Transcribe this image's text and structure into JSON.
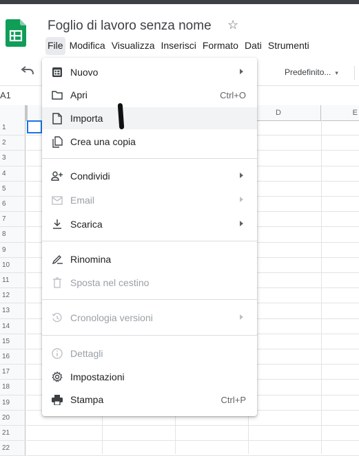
{
  "app": {
    "title": "Foglio di lavoro senza nome",
    "star_icon": "star-outline-icon",
    "logo_icon": "google-sheets-logo-icon"
  },
  "menubar": [
    "File",
    "Modifica",
    "Visualizza",
    "Inserisci",
    "Formato",
    "Dati",
    "Strumenti"
  ],
  "active_menu": "File",
  "toolbar": {
    "undo_icon": "undo-icon",
    "font": "Predefinito...",
    "font_caret": "▾"
  },
  "name_box": "A1",
  "grid": {
    "col_headers": [
      "D",
      "E"
    ],
    "row_headers": [
      "1",
      "2",
      "3",
      "4",
      "5",
      "6",
      "7",
      "8",
      "9",
      "10",
      "11",
      "12",
      "13",
      "14",
      "15",
      "16",
      "17",
      "18",
      "19",
      "20",
      "21",
      "22"
    ]
  },
  "file_menu": {
    "items": [
      {
        "label": "Nuovo",
        "icon": "new-spreadsheet-icon",
        "submenu": true,
        "disabled": false
      },
      {
        "label": "Apri",
        "icon": "folder-icon",
        "shortcut": "Ctrl+O",
        "disabled": false
      },
      {
        "label": "Importa",
        "icon": "file-icon",
        "disabled": false,
        "highlighted": true
      },
      {
        "label": "Crea una copia",
        "icon": "copy-icon",
        "disabled": false
      },
      {
        "label": "Condividi",
        "icon": "share-person-icon",
        "submenu": true,
        "disabled": false
      },
      {
        "label": "Email",
        "icon": "email-icon",
        "submenu": true,
        "disabled": true
      },
      {
        "label": "Scarica",
        "icon": "download-icon",
        "submenu": true,
        "disabled": false
      },
      {
        "label": "Rinomina",
        "icon": "rename-icon",
        "disabled": false
      },
      {
        "label": "Sposta nel cestino",
        "icon": "trash-icon",
        "disabled": true
      },
      {
        "label": "Cronologia versioni",
        "icon": "history-icon",
        "submenu": true,
        "disabled": true
      },
      {
        "label": "Dettagli",
        "icon": "info-icon",
        "disabled": true
      },
      {
        "label": "Impostazioni",
        "icon": "gear-icon",
        "disabled": false
      },
      {
        "label": "Stampa",
        "icon": "print-icon",
        "shortcut": "Ctrl+P",
        "disabled": false
      }
    ]
  },
  "colors": {
    "accent": "#1a73e8",
    "sheets_green": "#0f9d58",
    "disabled": "#9aa0a6"
  }
}
